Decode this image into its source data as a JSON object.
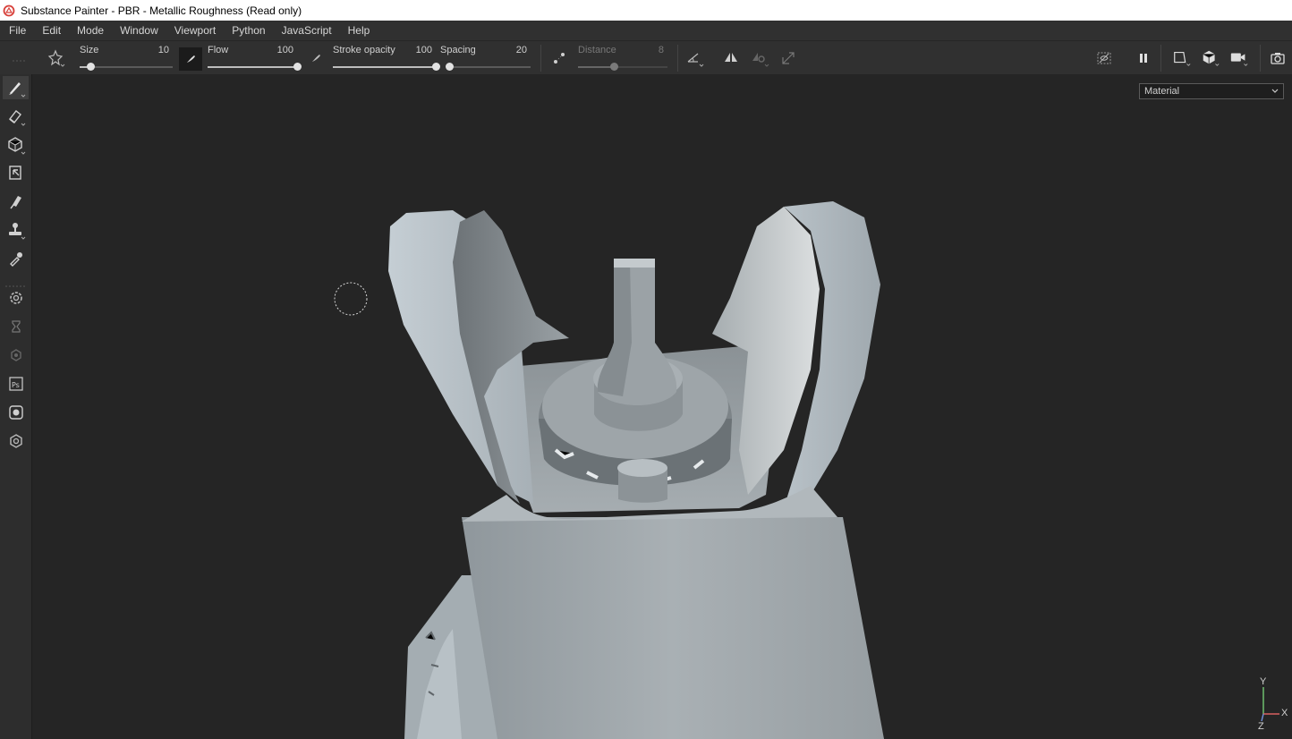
{
  "window": {
    "title": "Substance Painter - PBR - Metallic Roughness (Read only)"
  },
  "menu": [
    "File",
    "Edit",
    "Mode",
    "Window",
    "Viewport",
    "Python",
    "JavaScript",
    "Help"
  ],
  "toolbar": {
    "size": {
      "label": "Size",
      "value": "10",
      "level": 0.12
    },
    "flow": {
      "label": "Flow",
      "value": "100",
      "level": 1.0
    },
    "stroke_opacity": {
      "label": "Stroke opacity",
      "value": "100",
      "level": 1.0
    },
    "spacing": {
      "label": "Spacing",
      "value": "20",
      "level": 0.0
    },
    "distance": {
      "label": "Distance",
      "value": "8",
      "level": 0.4,
      "disabled": true
    }
  },
  "viewport": {
    "display_mode": "Material"
  },
  "axis": {
    "y": "Y",
    "x": "X",
    "z": "Z"
  },
  "colors": {
    "accent": "#d8403a",
    "panel": "#303030",
    "viewport": "#252525"
  }
}
